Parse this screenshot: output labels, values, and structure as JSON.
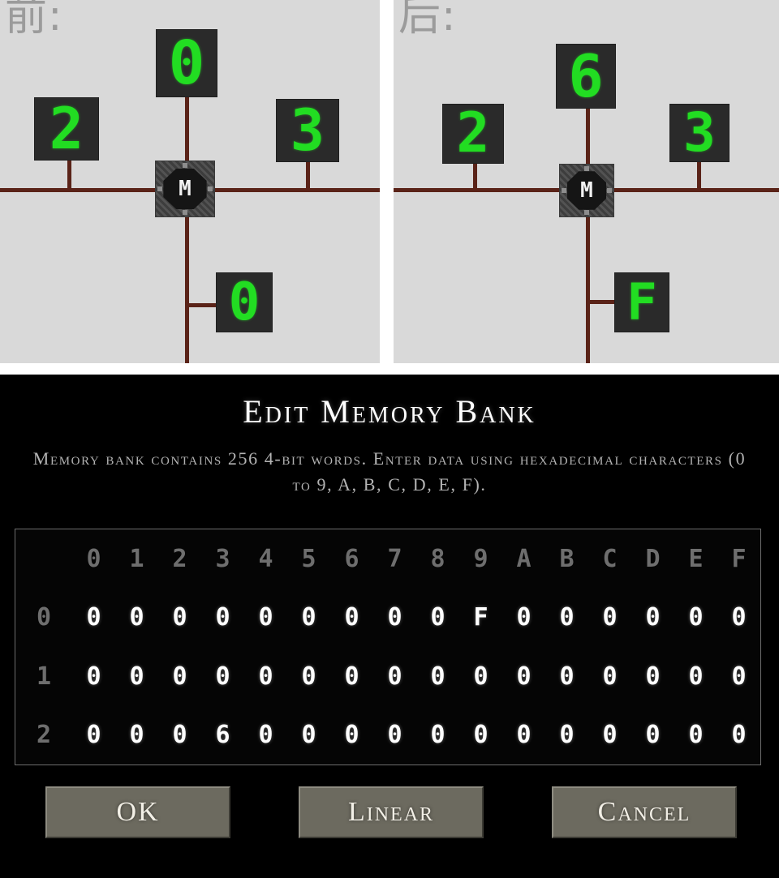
{
  "comparison": {
    "before": {
      "label": "前:",
      "block_letter": "M",
      "displays": {
        "top": "0",
        "left": "2",
        "right": "3",
        "bottom": "0"
      }
    },
    "after": {
      "label": "后:",
      "block_letter": "M",
      "displays": {
        "top": "6",
        "left": "2",
        "right": "3",
        "bottom": "F"
      }
    }
  },
  "dialog": {
    "title": "Edit Memory Bank",
    "description": "Memory bank contains 256 4-bit words. Enter data using hexadecimal characters (0 to 9, A, B, C, D, E, F).",
    "grid": {
      "column_headers": [
        "0",
        "1",
        "2",
        "3",
        "4",
        "5",
        "6",
        "7",
        "8",
        "9",
        "A",
        "B",
        "C",
        "D",
        "E",
        "F"
      ],
      "row_labels": [
        "0",
        "1",
        "2"
      ],
      "rows": [
        [
          "0",
          "0",
          "0",
          "0",
          "0",
          "0",
          "0",
          "0",
          "0",
          "F",
          "0",
          "0",
          "0",
          "0",
          "0",
          "0"
        ],
        [
          "0",
          "0",
          "0",
          "0",
          "0",
          "0",
          "0",
          "0",
          "0",
          "0",
          "0",
          "0",
          "0",
          "0",
          "0",
          "0"
        ],
        [
          "0",
          "0",
          "0",
          "6",
          "0",
          "0",
          "0",
          "0",
          "0",
          "0",
          "0",
          "0",
          "0",
          "0",
          "0",
          "0"
        ]
      ]
    },
    "buttons": {
      "ok": "OK",
      "linear": "Linear",
      "cancel": "Cancel"
    }
  },
  "colors": {
    "segment_green": "#22dd22",
    "wire_red": "#5a2318",
    "panel_bg": "#d9d9d9",
    "dialog_bg": "#000000",
    "button_face": "#6c6a5f",
    "dim_text": "#6e6e6e"
  }
}
